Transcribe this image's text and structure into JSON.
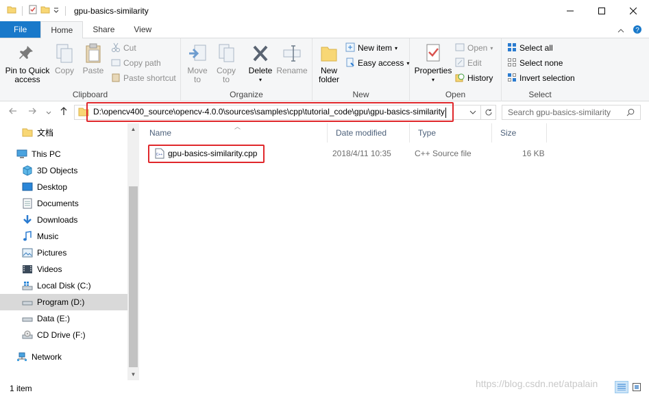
{
  "window": {
    "title": "gpu-basics-similarity",
    "controls": [
      "minimize",
      "maximize",
      "close"
    ]
  },
  "ribbon": {
    "tabs": [
      "File",
      "Home",
      "Share",
      "View"
    ],
    "active_tab": "Home",
    "groups": {
      "clipboard": {
        "label": "Clipboard",
        "pin": "Pin to Quick\naccess",
        "copy": "Copy",
        "paste": "Paste",
        "cut": "Cut",
        "copy_path": "Copy path",
        "paste_shortcut": "Paste shortcut"
      },
      "organize": {
        "label": "Organize",
        "move_to": "Move\nto",
        "copy_to": "Copy\nto",
        "delete": "Delete",
        "rename": "Rename"
      },
      "new": {
        "label": "New",
        "new_folder": "New\nfolder",
        "new_item": "New item",
        "easy_access": "Easy access"
      },
      "open": {
        "label": "Open",
        "properties": "Properties",
        "open": "Open",
        "edit": "Edit",
        "history": "History"
      },
      "select": {
        "label": "Select",
        "select_all": "Select all",
        "select_none": "Select none",
        "invert_selection": "Invert selection"
      }
    }
  },
  "address": {
    "path": "D:\\opencv400_source\\opencv-4.0.0\\sources\\samples\\cpp\\tutorial_code\\gpu\\gpu-basics-similarity",
    "search_placeholder": "Search gpu-basics-similarity"
  },
  "navpane": {
    "items": [
      {
        "label": "文档",
        "icon": "folder-icon"
      },
      {
        "label": "This PC",
        "icon": "computer-icon"
      },
      {
        "label": "3D Objects",
        "icon": "cube-icon"
      },
      {
        "label": "Desktop",
        "icon": "desktop-icon"
      },
      {
        "label": "Documents",
        "icon": "document-icon"
      },
      {
        "label": "Downloads",
        "icon": "download-icon"
      },
      {
        "label": "Music",
        "icon": "music-icon"
      },
      {
        "label": "Pictures",
        "icon": "picture-icon"
      },
      {
        "label": "Videos",
        "icon": "video-icon"
      },
      {
        "label": "Local Disk (C:)",
        "icon": "windows-drive-icon"
      },
      {
        "label": "Program (D:)",
        "icon": "drive-icon"
      },
      {
        "label": "Data (E:)",
        "icon": "drive-icon"
      },
      {
        "label": "CD Drive (F:)",
        "icon": "cd-drive-icon"
      },
      {
        "label": "Network",
        "icon": "network-icon"
      }
    ],
    "selected": "Program (D:)"
  },
  "filelist": {
    "columns": [
      "Name",
      "Date modified",
      "Type",
      "Size"
    ],
    "files": [
      {
        "name": "gpu-basics-similarity.cpp",
        "date": "2018/4/11 10:35",
        "type": "C++ Source file",
        "size": "16 KB"
      }
    ]
  },
  "status": {
    "item_count": "1 item",
    "watermark": "https://blog.csdn.net/atpalain"
  },
  "colors": {
    "file_tab": "#1979ca",
    "highlight_border": "#e0262a",
    "selected_nav": "#d9d9d9"
  }
}
